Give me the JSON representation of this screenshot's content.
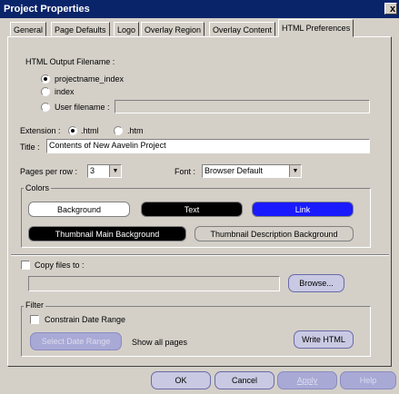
{
  "window": {
    "title": "Project Properties",
    "close_glyph": "x"
  },
  "tabs": [
    "General",
    "Page Defaults",
    "Logo",
    "Overlay Region",
    "Overlay Content",
    "HTML Preferences"
  ],
  "output": {
    "label": "HTML Output Filename :",
    "option1": "projectname_index",
    "option2": "index",
    "option3": "User filename :",
    "user_filename_value": ""
  },
  "extension": {
    "label": "Extension :",
    "html": ".html",
    "htm": ".htm"
  },
  "title": {
    "label": "Title :",
    "value": "Contents of New Aavelin Project"
  },
  "pages_per_row": {
    "label": "Pages per row :",
    "value": "3"
  },
  "font": {
    "label": "Font :",
    "value": "Browser Default"
  },
  "colors": {
    "label": "Colors",
    "background": "Background",
    "text": "Text",
    "link": "Link",
    "thumb_main": "Thumbnail Main Background",
    "thumb_desc": "Thumbnail Description Background",
    "swatch_background": "#ffffff",
    "swatch_text": "#000000",
    "swatch_link": "#1a1aff",
    "swatch_thumb_main": "#000000",
    "swatch_thumb_desc": "#d4d0c8"
  },
  "copy": {
    "label": "Copy files to :",
    "path": "",
    "browse": "Browse..."
  },
  "filter": {
    "label": "Filter",
    "constrain": "Constrain Date Range",
    "select_range": "Select Date Range",
    "show_all": "Show all pages",
    "write_html": "Write HTML"
  },
  "footer": {
    "ok": "OK",
    "cancel": "Cancel",
    "apply": "Apply",
    "help": "Help"
  }
}
